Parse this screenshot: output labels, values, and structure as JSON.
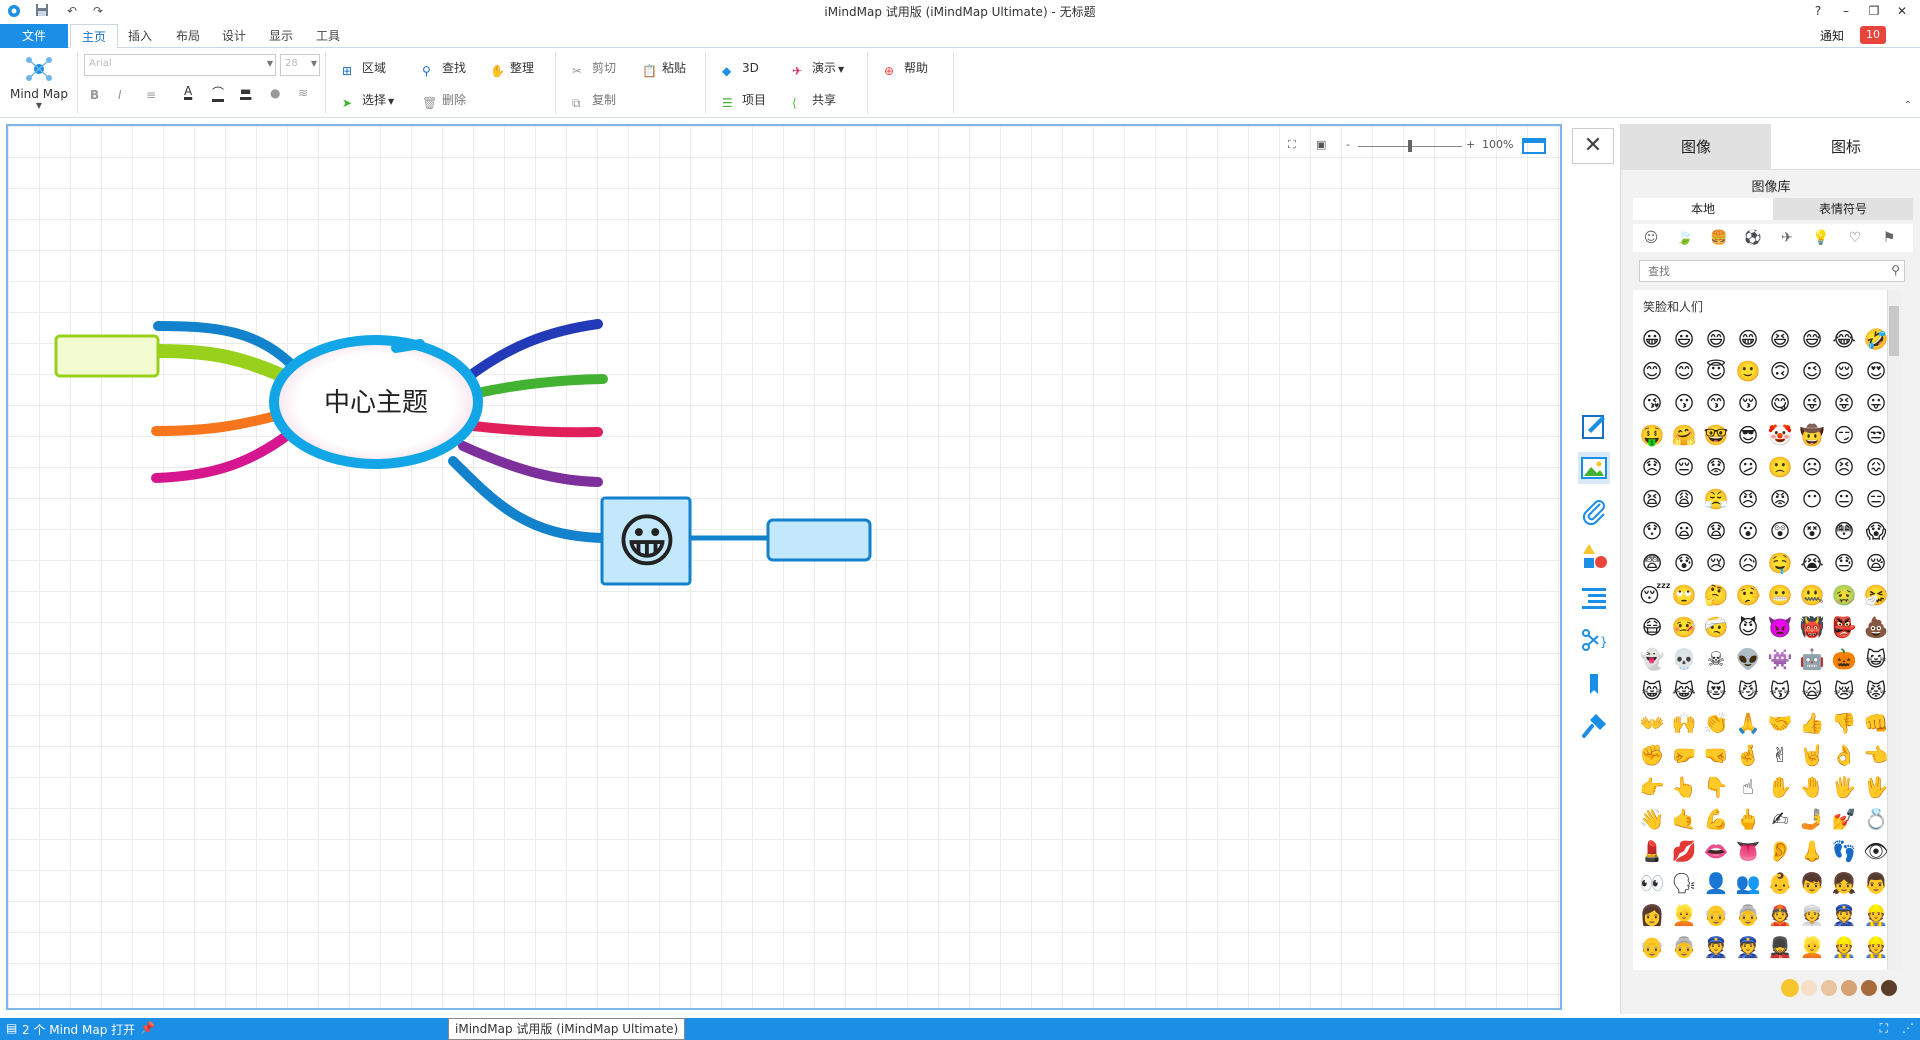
{
  "window": {
    "title": "iMindMap 试用版 (iMindMap Ultimate) - 无标题",
    "help": "?",
    "minimize": "–",
    "restore": "❐",
    "close": "✕"
  },
  "tabs": [
    {
      "label": "文件"
    },
    {
      "label": "主页"
    },
    {
      "label": "插入"
    },
    {
      "label": "布局"
    },
    {
      "label": "设计"
    },
    {
      "label": "显示"
    },
    {
      "label": "工具"
    }
  ],
  "notifications": {
    "label": "通知",
    "count": "10"
  },
  "ribbon": {
    "mindmap_label": "Mind Map",
    "font_name": "Arial",
    "font_size": "28",
    "area": "区域",
    "find": "查找",
    "organize": "整理",
    "select": "选择",
    "delete": "删除",
    "cut": "剪切",
    "paste": "粘贴",
    "copy": "复制",
    "three_d": "3D",
    "present": "演示",
    "project": "项目",
    "share": "共享",
    "help": "帮助"
  },
  "canvas": {
    "central_topic": "中心主题",
    "zoom": "100%",
    "branch_colors": [
      "#97d11c",
      "#f7761d",
      "#d6168e",
      "#233ab8",
      "#43b233",
      "#e0205a",
      "#7d2f9c",
      "#1282cc"
    ]
  },
  "panel": {
    "tab_image": "图像",
    "tab_icon": "图标",
    "library_title": "图像库",
    "sub_local": "本地",
    "sub_emoji": "表情符号",
    "search_placeholder": "查找",
    "section_title": "笑脸和人们",
    "categories": [
      "☺",
      "🍃",
      "🍔",
      "⚽",
      "✈",
      "💡",
      "♡",
      "⚑"
    ],
    "emojis": [
      "😀",
      "😃",
      "😄",
      "😁",
      "😆",
      "😅",
      "😂",
      "🤣",
      "😊",
      "😊",
      "😇",
      "🙂",
      "🙃",
      "😉",
      "😌",
      "😍",
      "😘",
      "😗",
      "😙",
      "😚",
      "😋",
      "😜",
      "😝",
      "😛",
      "🤑",
      "🤗",
      "🤓",
      "😎",
      "🤡",
      "🤠",
      "😏",
      "😒",
      "😞",
      "😔",
      "😟",
      "😕",
      "🙁",
      "☹",
      "😣",
      "😖",
      "😫",
      "😩",
      "😤",
      "😠",
      "😡",
      "😶",
      "😐",
      "😑",
      "😯",
      "😦",
      "😧",
      "😮",
      "😲",
      "😵",
      "😳",
      "😱",
      "😨",
      "😰",
      "😢",
      "😥",
      "🤤",
      "😭",
      "😓",
      "😪",
      "😴",
      "🙄",
      "🤔",
      "🤥",
      "😬",
      "🤐",
      "🤢",
      "🤧",
      "😷",
      "🤒",
      "🤕",
      "😈",
      "👿",
      "👹",
      "👺",
      "💩",
      "👻",
      "💀",
      "☠",
      "👽",
      "👾",
      "🤖",
      "🎃",
      "😺",
      "😸",
      "😹",
      "😻",
      "😼",
      "😽",
      "🙀",
      "😿",
      "😾",
      "👐",
      "🙌",
      "👏",
      "🙏",
      "🤝",
      "👍",
      "👎",
      "👊",
      "✊",
      "🤛",
      "🤜",
      "🤞",
      "✌",
      "🤘",
      "👌",
      "👈",
      "👉",
      "👆",
      "👇",
      "☝",
      "✋",
      "🤚",
      "🖐",
      "🖖",
      "👋",
      "🤙",
      "💪",
      "🖕",
      "✍",
      "🤳",
      "💅",
      "💍",
      "💄",
      "💋",
      "👄",
      "👅",
      "👂",
      "👃",
      "👣",
      "👁",
      "👀",
      "🗣",
      "👤",
      "👥",
      "👶",
      "👦",
      "👧",
      "👨",
      "👩",
      "👱",
      "👴",
      "👵",
      "👲",
      "👳",
      "👮",
      "👷",
      "👴",
      "👵",
      "👮",
      "👮",
      "💂",
      "👱",
      "👷",
      "👷"
    ],
    "skin_tones": [
      "#f7c62f",
      "#f5dfc8",
      "#e9c4a0",
      "#d7a373",
      "#a86b3c",
      "#5c3d2a"
    ]
  },
  "status": {
    "open_maps": "2 个 Mind Map 打开",
    "tooltip": "iMindMap 试用版 (iMindMap Ultimate)"
  }
}
